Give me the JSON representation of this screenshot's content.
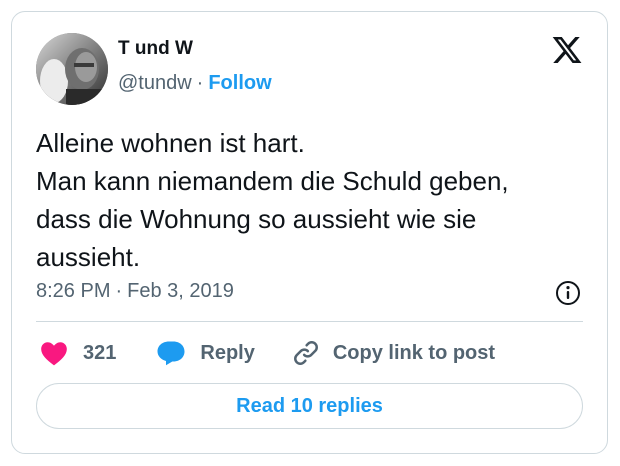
{
  "author": {
    "name": "T und W",
    "handle": "@tundw",
    "separator": "·",
    "follow_label": "Follow"
  },
  "tweet": {
    "lines": [
      "Alleine wohnen ist hart.",
      "Man kann niemandem die Schuld geben,",
      "dass die Wohnung so aussieht wie sie",
      "aussieht."
    ],
    "time": "8:26 PM",
    "separator": "·",
    "date": "Feb 3, 2019"
  },
  "actions": {
    "like_count": "321",
    "reply_label": "Reply",
    "copy_link_label": "Copy link to post"
  },
  "read_replies_label": "Read 10 replies",
  "icons": {
    "logo": "x-logo-icon",
    "info": "info-icon",
    "like": "heart-icon",
    "reply": "speech-bubble-icon",
    "copy": "link-icon"
  },
  "colors": {
    "accent": "#1d9bf0",
    "like": "#f91880",
    "text": "#0f1419",
    "secondary": "#536471",
    "border": "#cfd9de"
  }
}
